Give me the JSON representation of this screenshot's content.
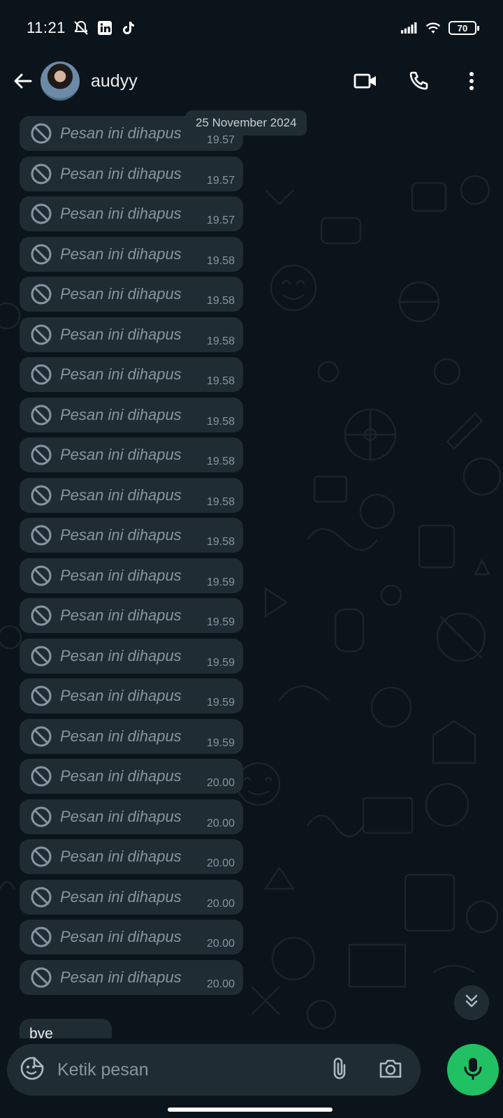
{
  "status_bar": {
    "time": "11:21",
    "battery": "70",
    "icons": [
      "mute-bell-icon",
      "linkedin-icon",
      "tiktok-icon",
      "signal-icon",
      "wifi-icon",
      "battery-icon"
    ]
  },
  "header": {
    "contact_name": "audyy",
    "actions": [
      "video-call-icon",
      "voice-call-icon",
      "more-menu-icon"
    ]
  },
  "chat": {
    "date_label": "25 November 2024",
    "messages": [
      {
        "text": "Pesan ini dihapus",
        "time": "19.57"
      },
      {
        "text": "Pesan ini dihapus",
        "time": "19.57"
      },
      {
        "text": "Pesan ini dihapus",
        "time": "19.57"
      },
      {
        "text": "Pesan ini dihapus",
        "time": "19.58"
      },
      {
        "text": "Pesan ini dihapus",
        "time": "19.58"
      },
      {
        "text": "Pesan ini dihapus",
        "time": "19.58"
      },
      {
        "text": "Pesan ini dihapus",
        "time": "19.58"
      },
      {
        "text": "Pesan ini dihapus",
        "time": "19.58"
      },
      {
        "text": "Pesan ini dihapus",
        "time": "19.58"
      },
      {
        "text": "Pesan ini dihapus",
        "time": "19.58"
      },
      {
        "text": "Pesan ini dihapus",
        "time": "19.58"
      },
      {
        "text": "Pesan ini dihapus",
        "time": "19.59"
      },
      {
        "text": "Pesan ini dihapus",
        "time": "19.59"
      },
      {
        "text": "Pesan ini dihapus",
        "time": "19.59"
      },
      {
        "text": "Pesan ini dihapus",
        "time": "19.59"
      },
      {
        "text": "Pesan ini dihapus",
        "time": "19.59"
      },
      {
        "text": "Pesan ini dihapus",
        "time": "20.00"
      },
      {
        "text": "Pesan ini dihapus",
        "time": "20.00"
      },
      {
        "text": "Pesan ini dihapus",
        "time": "20.00"
      },
      {
        "text": "Pesan ini dihapus",
        "time": "20.00"
      },
      {
        "text": "Pesan ini dihapus",
        "time": "20.00"
      },
      {
        "text": "Pesan ini dihapus",
        "time": "20.00"
      }
    ],
    "partial_message": "bye"
  },
  "composer": {
    "placeholder": "Ketik pesan"
  },
  "colors": {
    "background": "#0b141a",
    "bubble": "#1f2c33",
    "accent": "#21c063",
    "muted_text": "#8696a0"
  }
}
